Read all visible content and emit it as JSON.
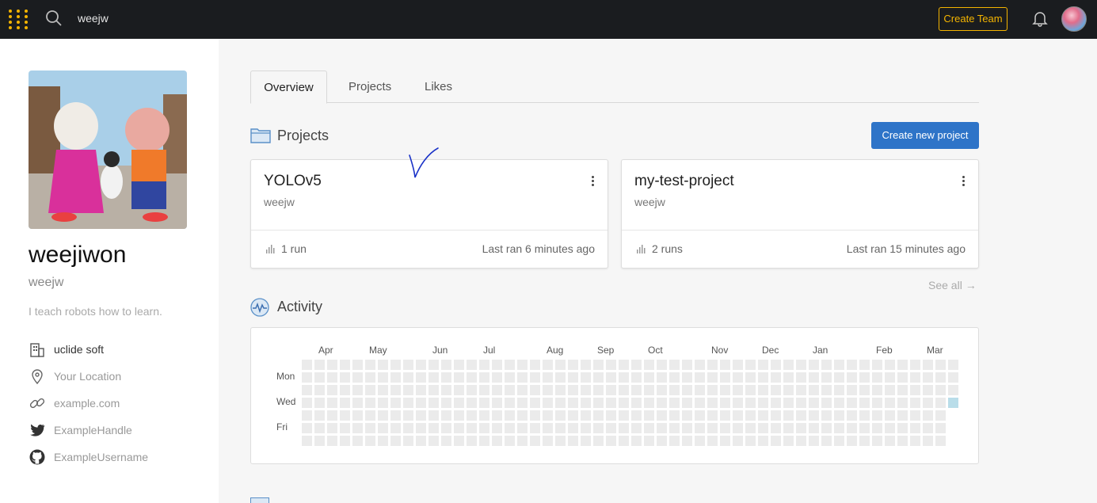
{
  "topbar": {
    "search_value": "weejw",
    "create_team_label": "Create Team"
  },
  "profile": {
    "display_name": "weejiwon",
    "username": "weejw",
    "bio": "I teach robots how to learn.",
    "company": "uclide soft",
    "location": "Your Location",
    "website": "example.com",
    "twitter": "ExampleHandle",
    "github": "ExampleUsername"
  },
  "tabs": [
    {
      "label": "Overview"
    },
    {
      "label": "Projects"
    },
    {
      "label": "Likes"
    }
  ],
  "projects_section": {
    "title": "Projects",
    "create_label": "Create new project",
    "see_all_label": "See all →",
    "cards": [
      {
        "title": "YOLOv5",
        "owner": "weejw",
        "runs": "1 run",
        "last_ran": "Last ran 6 minutes ago"
      },
      {
        "title": "my-test-project",
        "owner": "weejw",
        "runs": "2 runs",
        "last_ran": "Last ran 15 minutes ago"
      }
    ]
  },
  "activity_section": {
    "title": "Activity",
    "months": [
      "Apr",
      "May",
      "Jun",
      "Jul",
      "Aug",
      "Sep",
      "Oct",
      "Nov",
      "Dec",
      "Jan",
      "Feb",
      "Mar"
    ],
    "days": [
      "Mon",
      "Wed",
      "Fri"
    ],
    "weeks": 52,
    "active_cells": [
      {
        "week": 51,
        "day": 3
      }
    ]
  },
  "colors": {
    "accent": "#f4b400",
    "primary_button": "#2e74c8",
    "topbar": "#1a1c1f",
    "activity_on": "#b9dde9",
    "activity_off": "#ebebeb"
  }
}
